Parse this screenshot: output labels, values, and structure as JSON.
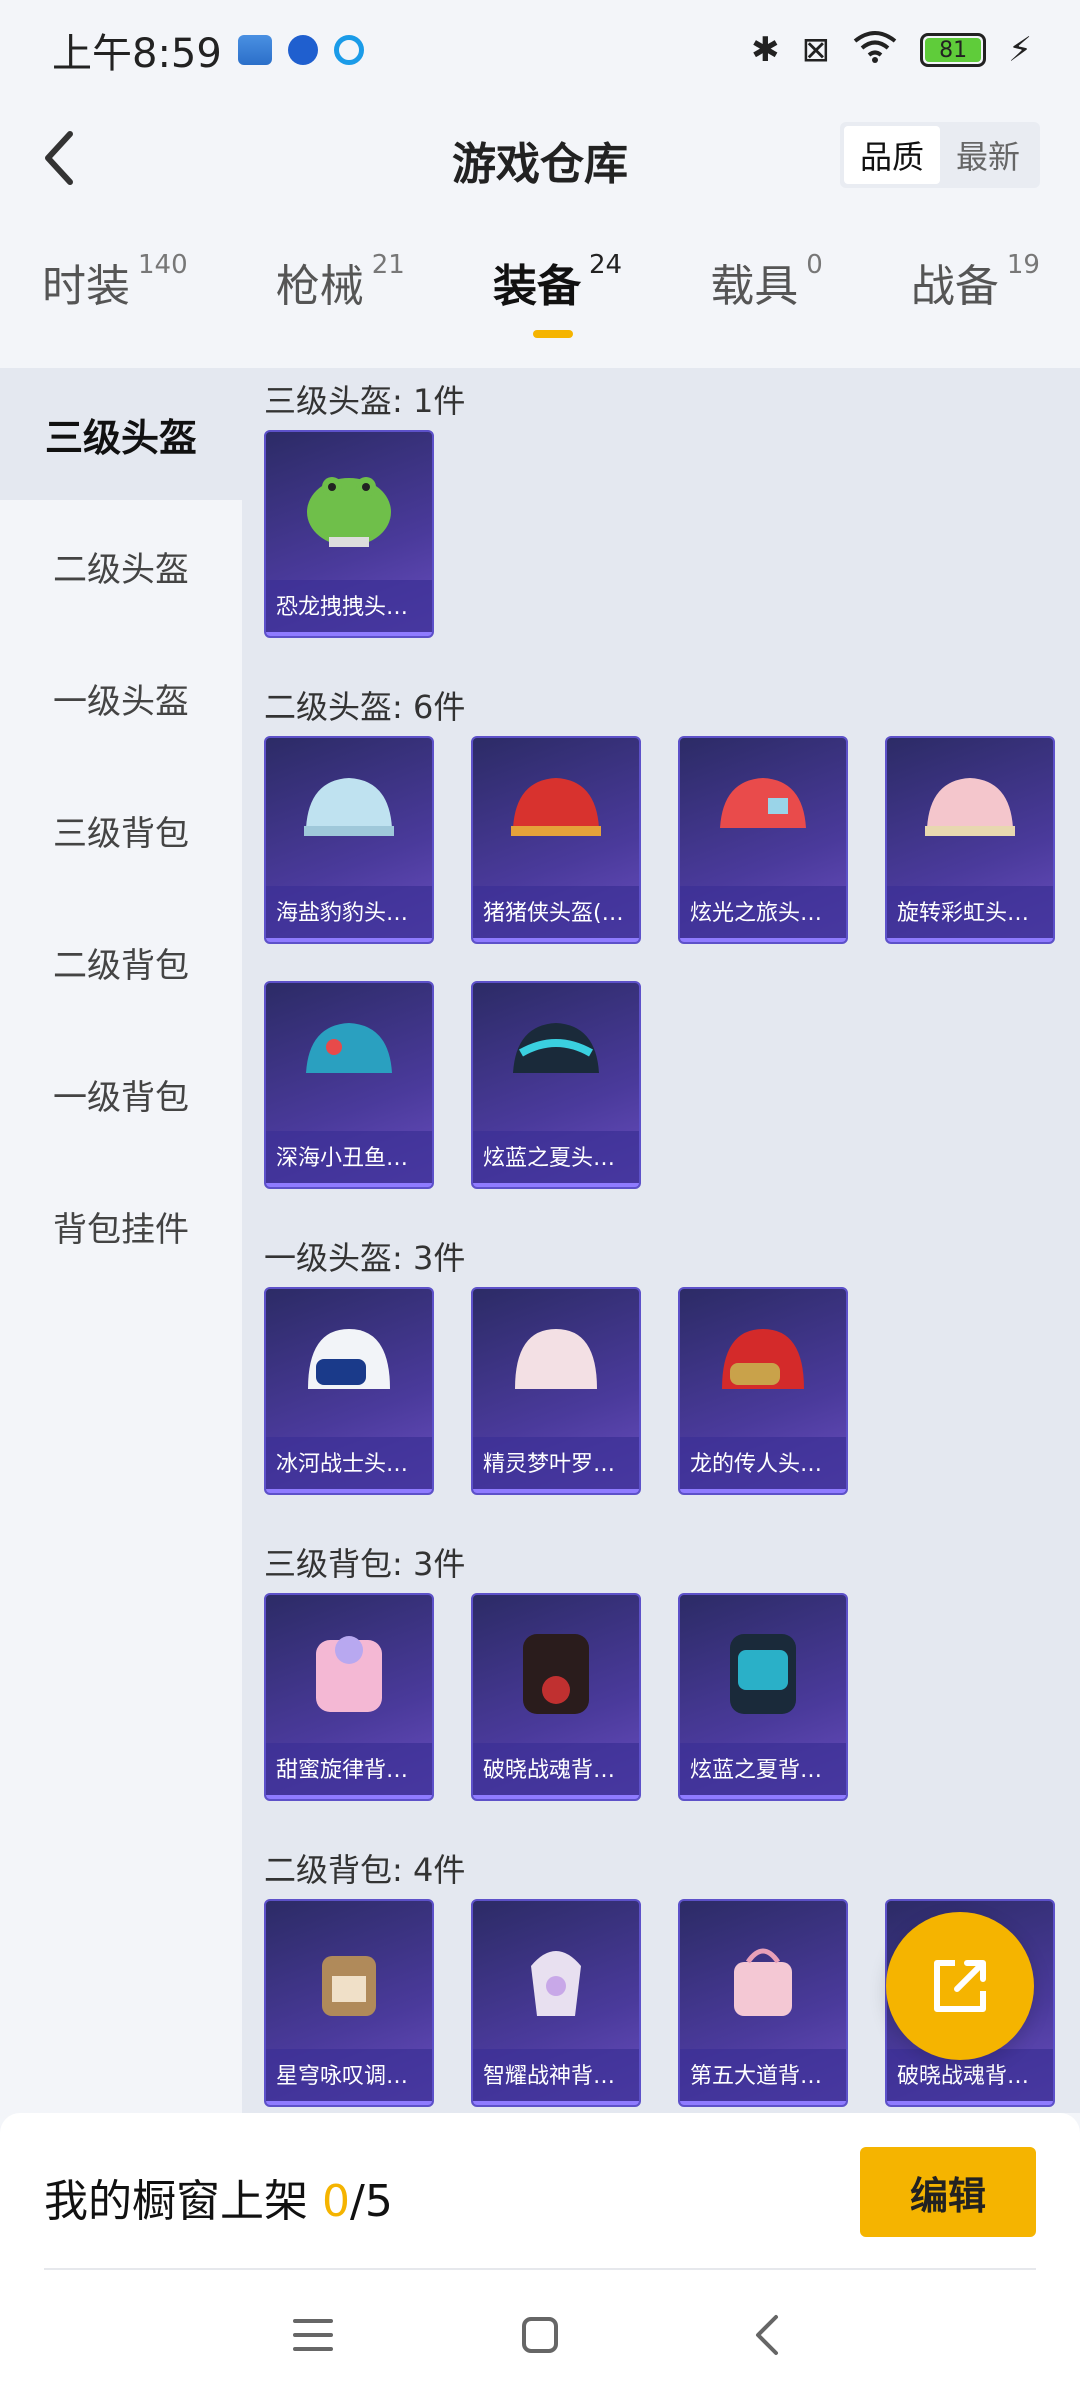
{
  "status_bar": {
    "time": "上午8:59",
    "battery": "81"
  },
  "header": {
    "title": "游戏仓库",
    "sort": [
      "品质",
      "最新"
    ],
    "sort_active": 0
  },
  "tabs": [
    {
      "label": "时装",
      "count": "140"
    },
    {
      "label": "枪械",
      "count": "21"
    },
    {
      "label": "装备",
      "count": "24"
    },
    {
      "label": "载具",
      "count": "0"
    },
    {
      "label": "战备",
      "count": "19"
    }
  ],
  "active_tab": 2,
  "sidebar": [
    "三级头盔",
    "二级头盔",
    "一级头盔",
    "三级背包",
    "二级背包",
    "一级背包",
    "背包挂件"
  ],
  "sections": [
    {
      "title": "三级头盔: 1件",
      "items": [
        "恐龙拽拽头…"
      ]
    },
    {
      "title": "二级头盔: 6件",
      "items": [
        "海盐豹豹头…",
        "猪猪侠头盔(…",
        "炫光之旅头…",
        "旋转彩虹头…",
        "深海小丑鱼…",
        "炫蓝之夏头…"
      ]
    },
    {
      "title": "一级头盔: 3件",
      "items": [
        "冰河战士头…",
        "精灵梦叶罗…",
        "龙的传人头…"
      ]
    },
    {
      "title": "三级背包: 3件",
      "items": [
        "甜蜜旋律背…",
        "破晓战魂背…",
        "炫蓝之夏背…"
      ]
    },
    {
      "title": "二级背包: 4件",
      "items": [
        "星穹咏叹调…",
        "智耀战神背…",
        "第五大道背…",
        "破晓战魂背…"
      ]
    }
  ],
  "bottom": {
    "label": "我的橱窗上架",
    "current": "0",
    "total": "/5",
    "edit": "编辑"
  },
  "colors": {
    "accent": "#f5b400",
    "card_bg": "#3b3486"
  }
}
